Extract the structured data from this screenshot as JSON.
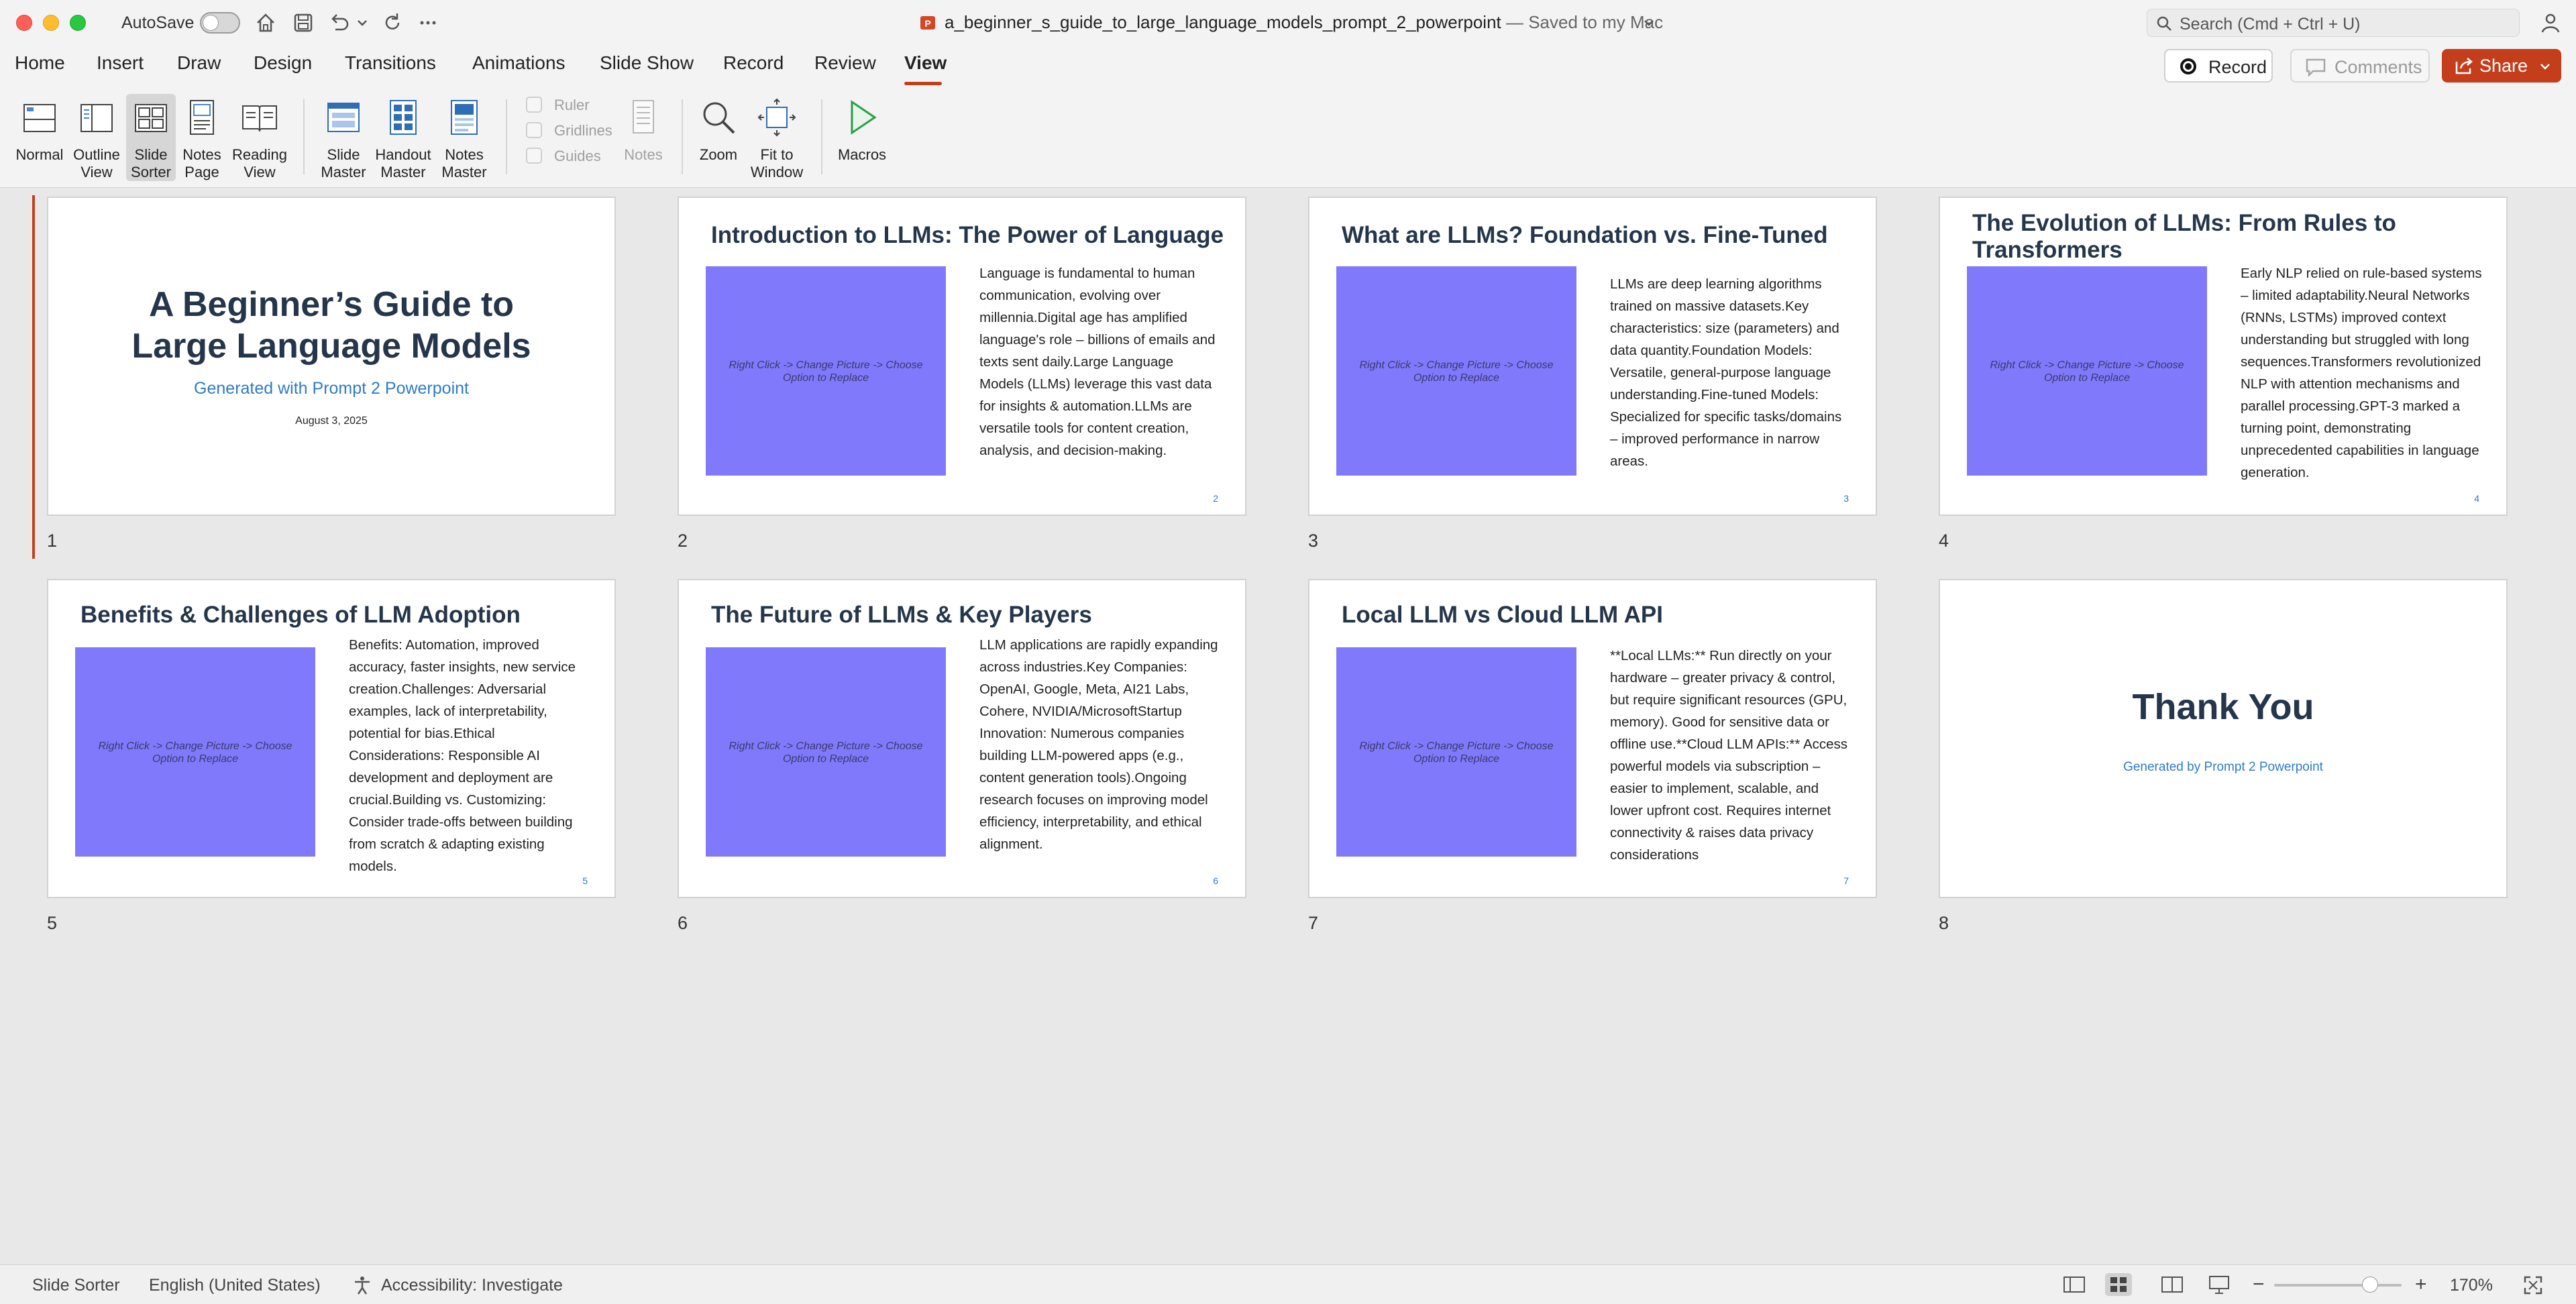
{
  "titlebar": {
    "autosave_label": "AutoSave",
    "doc_name": "a_beginner_s_guide_to_large_language_models_prompt_2_powerpoint",
    "saved_status": " — Saved to my Mac",
    "search_placeholder": "Search (Cmd + Ctrl + U)"
  },
  "tabs": [
    "Home",
    "Insert",
    "Draw",
    "Design",
    "Transitions",
    "Animations",
    "Slide Show",
    "Record",
    "Review",
    "View"
  ],
  "active_tab": "View",
  "actions": {
    "record": "Record",
    "comments": "Comments",
    "share": "Share"
  },
  "ribbon": {
    "normal": "Normal",
    "outline_view": "Outline View",
    "slide_sorter": "Slide Sorter",
    "notes_page": "Notes Page",
    "reading_view": "Reading View",
    "slide_master": "Slide Master",
    "handout_master": "Handout Master",
    "notes_master": "Notes Master",
    "ruler": "Ruler",
    "gridlines": "Gridlines",
    "guides": "Guides",
    "notes": "Notes",
    "zoom": "Zoom",
    "fit_to_window": "Fit to Window",
    "macros": "Macros"
  },
  "placeholder_text": "Right Click -> Change Picture -> Choose Option to Replace",
  "slides": [
    {
      "num": "1",
      "title": "A Beginner’s Guide to Large Language Models",
      "subtitle": "Generated with Prompt 2 Powerpoint",
      "date": "August 3, 2025"
    },
    {
      "num": "2",
      "title": "Introduction to LLMs: The Power of Language",
      "body": "Language is fundamental to human communication, evolving over millennia.Digital age has amplified language's role – billions of emails and texts sent daily.Large Language Models (LLMs) leverage this vast data for insights & automation.LLMs are versatile tools for content creation, analysis, and decision-making.",
      "page": "2"
    },
    {
      "num": "3",
      "title": "What are LLMs? Foundation vs. Fine-Tuned",
      "body": "LLMs are deep learning algorithms trained on massive datasets.Key characteristics: size (parameters) and data quantity.Foundation Models: Versatile, general-purpose language understanding.Fine-tuned Models: Specialized for specific tasks/domains – improved performance in narrow areas.",
      "page": "3"
    },
    {
      "num": "4",
      "title": "The Evolution of LLMs: From Rules to Transformers",
      "body": "Early NLP relied on rule-based systems – limited adaptability.Neural Networks (RNNs, LSTMs) improved context understanding but struggled with long sequences.Transformers revolutionized NLP with attention mechanisms and parallel processing.GPT-3 marked a turning point, demonstrating unprecedented capabilities in language generation.",
      "page": "4"
    },
    {
      "num": "5",
      "title": "Benefits & Challenges of LLM Adoption",
      "body": "Benefits: Automation, improved accuracy, faster insights, new service creation.Challenges: Adversarial examples, lack of interpretability, potential for bias.Ethical Considerations: Responsible AI development and deployment are crucial.Building vs. Customizing: Consider trade-offs between building from scratch & adapting existing models.",
      "page": "5"
    },
    {
      "num": "6",
      "title": "The Future of LLMs & Key Players",
      "body": "LLM applications are rapidly expanding across industries.Key Companies: OpenAI, Google, Meta, AI21 Labs, Cohere, NVIDIA/MicrosoftStartup Innovation: Numerous companies building LLM-powered apps (e.g., content generation tools).Ongoing research focuses on improving model efficiency, interpretability, and ethical alignment.",
      "page": "6"
    },
    {
      "num": "7",
      "title": "Local LLM vs Cloud LLM API",
      "body": "**Local LLMs:** Run directly on your hardware – greater privacy & control, but require significant resources (GPU, memory). Good for sensitive data or offline use.**Cloud LLM APIs:** Access powerful models via subscription – easier to implement, scalable, and lower upfront cost. Requires internet connectivity & raises data privacy considerations",
      "page": "7"
    },
    {
      "num": "8",
      "title": "Thank You",
      "subtitle": "Generated by Prompt 2 Powerpoint"
    }
  ],
  "status": {
    "view": "Slide Sorter",
    "language": "English (United States)",
    "accessibility": "Accessibility: Investigate",
    "zoom": "170%",
    "zoom_level_percent": 75
  },
  "colors": {
    "accent": "#c43e1c",
    "slide_title": "#26364a",
    "link_blue": "#2f7cc4",
    "placeholder_fill": "#8079fb"
  }
}
